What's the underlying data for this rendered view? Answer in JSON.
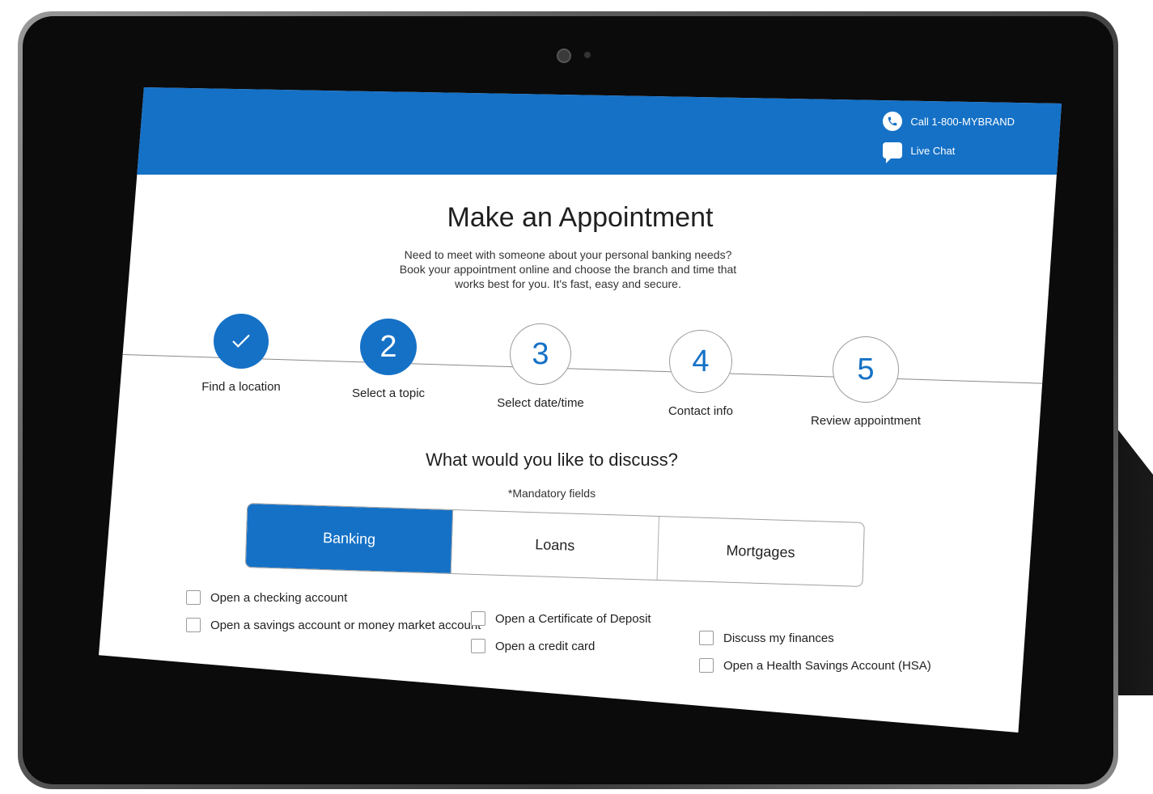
{
  "header": {
    "phone_label": "Call 1-800-MYBRAND",
    "chat_label": "Live Chat"
  },
  "page": {
    "title": "Make an Appointment",
    "intro": "Need to meet with someone about your personal banking needs? Book your appointment online and choose the branch and time that works best for you. It's fast, easy and secure."
  },
  "steps": [
    {
      "number": "",
      "label": "Find a location",
      "state": "done"
    },
    {
      "number": "2",
      "label": "Select a topic",
      "state": "active"
    },
    {
      "number": "3",
      "label": "Select date/time",
      "state": "todo"
    },
    {
      "number": "4",
      "label": "Contact info",
      "state": "todo"
    },
    {
      "number": "5",
      "label": "Review appointment",
      "state": "todo"
    }
  ],
  "form": {
    "question": "What would you like to discuss?",
    "mandatory": "*Mandatory fields",
    "tabs": [
      {
        "label": "Banking",
        "active": true
      },
      {
        "label": "Loans",
        "active": false
      },
      {
        "label": "Mortgages",
        "active": false
      }
    ],
    "options": [
      [
        "Open a checking account",
        "Open a savings account or money market account"
      ],
      [
        "Open a Certificate of Deposit",
        "Open a credit card"
      ],
      [
        "Discuss my finances",
        "Open a Health Savings Account (HSA)"
      ]
    ]
  },
  "colors": {
    "brand_blue": "#1571c6"
  }
}
